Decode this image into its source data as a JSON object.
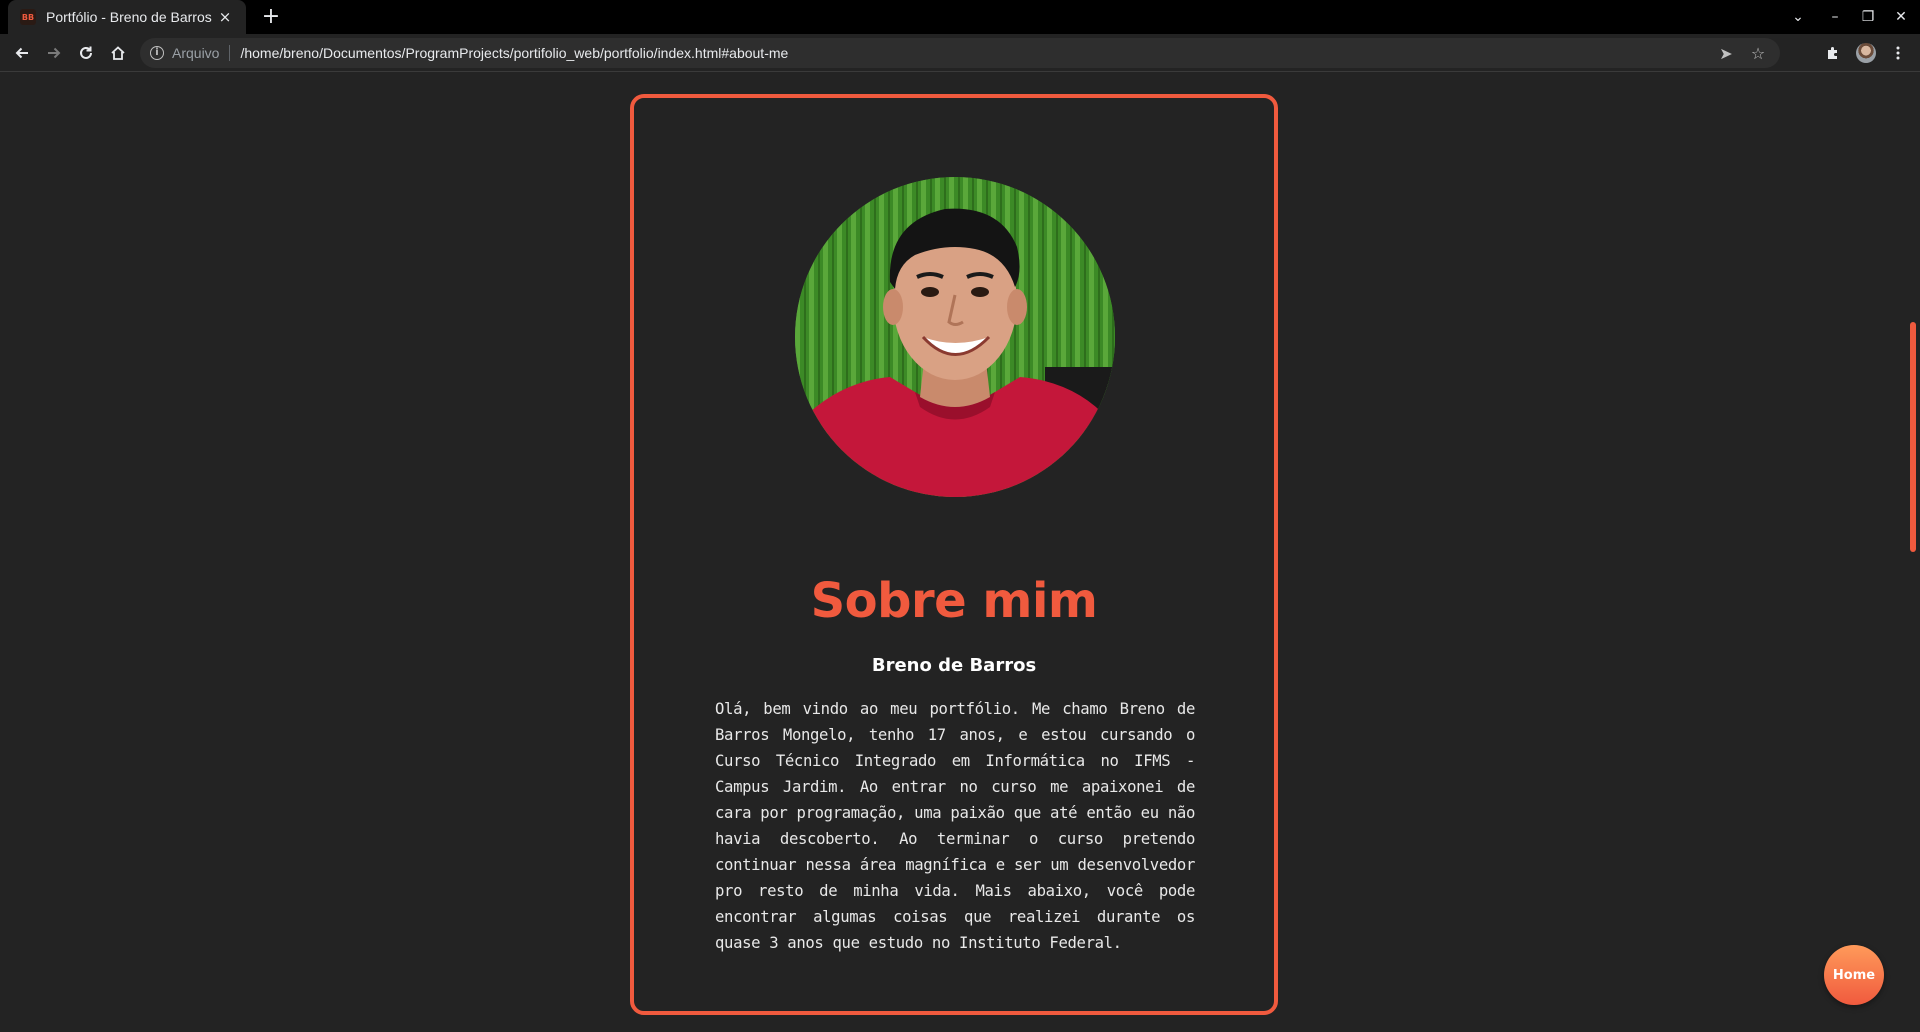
{
  "browser": {
    "tab": {
      "favicon_text": "BB",
      "title": "Portfólio - Breno de Barros",
      "close": "×"
    },
    "new_tab": "+",
    "window_controls": [
      "⌄",
      "–",
      "❐",
      "✕"
    ],
    "security_label": "Arquivo",
    "url": "/home/breno/Documentos/ProgramProjects/portifolio_web/portfolio/index.html#about-me"
  },
  "page": {
    "accent_color": "#f05a3e",
    "background_color": "#232323",
    "about": {
      "title": "Sobre mim",
      "name": "Breno de Barros",
      "bio": "Olá, bem vindo ao meu portfólio. Me chamo Breno de Barros Mongelo, tenho 17 anos, e estou cursando o Curso Técnico Integrado em Informática no IFMS - Campus Jardim. Ao entrar no curso me apaixonei de cara por programação, uma paixão que até então eu não havia descoberto. Ao terminar o curso pretendo continuar nessa área magnífica e ser um desenvolvedor pro resto de minha vida. Mais abaixo, você pode encontrar algumas coisas que realizei durante os quase 3 anos que estudo no Instituto Federal."
    },
    "home_button": "Home"
  }
}
